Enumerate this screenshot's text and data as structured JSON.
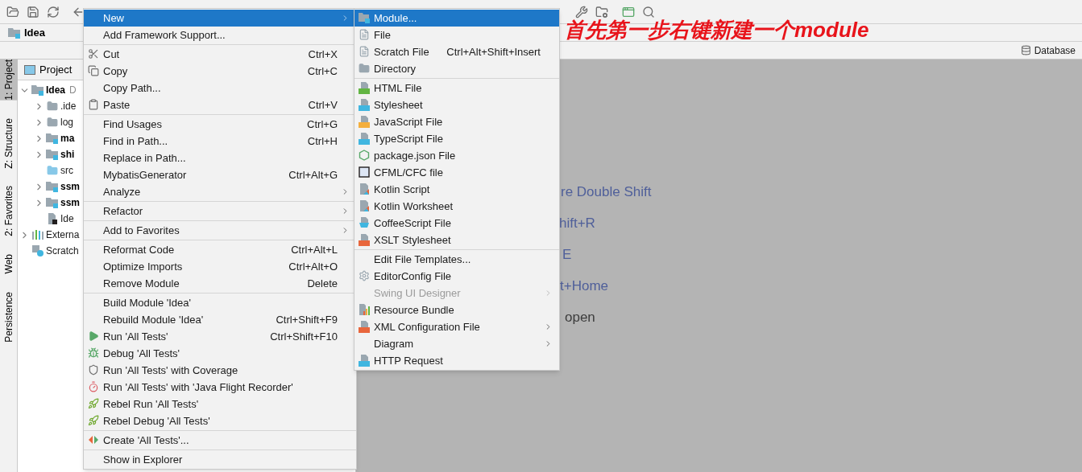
{
  "navbar": {
    "project": "Idea"
  },
  "tool_strip": {
    "database": "Database"
  },
  "side_tabs": [
    {
      "label": "1: Project",
      "selected": true
    },
    {
      "label": "Z: Structure",
      "selected": false
    },
    {
      "label": "2: Favorites",
      "selected": false
    },
    {
      "label": "Web",
      "selected": false
    },
    {
      "label": "Persistence",
      "selected": false
    }
  ],
  "project_panel": {
    "title": "Project",
    "tree": [
      {
        "label": "Idea",
        "suffix": "D",
        "kind": "module",
        "expanded": true,
        "children": [
          {
            "label": ".ide",
            "kind": "folder",
            "expanded": false
          },
          {
            "label": "log",
            "kind": "folder",
            "expanded": false
          },
          {
            "label": "ma",
            "kind": "module",
            "expanded": false
          },
          {
            "label": "shi",
            "kind": "module",
            "expanded": false
          },
          {
            "label": "src",
            "kind": "source"
          },
          {
            "label": "ssm",
            "kind": "module",
            "expanded": false
          },
          {
            "label": "ssm",
            "kind": "module",
            "expanded": false
          },
          {
            "label": "Ide",
            "kind": "file"
          }
        ]
      },
      {
        "label": "Externa",
        "kind": "library",
        "expanded": false
      },
      {
        "label": "Scratch",
        "kind": "scratch"
      }
    ]
  },
  "editor_hints": [
    "re Double Shift",
    "hift+R",
    "E",
    "t+Home",
    "open"
  ],
  "annotation": "首先第一步右键新建一个module",
  "context_menu": {
    "groups": [
      [
        {
          "label": "New",
          "selected": true,
          "submenu": true
        },
        {
          "label": "Add Framework Support...",
          "selected": false,
          "submenu": false
        }
      ],
      [
        {
          "label": "Cut",
          "shortcut": "Ctrl+X",
          "selected": false,
          "submenu": false
        },
        {
          "label": "Copy",
          "shortcut": "Ctrl+C",
          "selected": false,
          "submenu": false
        },
        {
          "label": "Copy Path...",
          "selected": false,
          "submenu": false
        },
        {
          "label": "Paste",
          "shortcut": "Ctrl+V",
          "selected": false,
          "submenu": false
        }
      ],
      [
        {
          "label": "Find Usages",
          "shortcut": "Ctrl+G",
          "selected": false,
          "submenu": false
        },
        {
          "label": "Find in Path...",
          "shortcut": "Ctrl+H",
          "selected": false,
          "submenu": false
        },
        {
          "label": "Replace in Path...",
          "selected": false,
          "submenu": false
        },
        {
          "label": "MybatisGenerator",
          "shortcut": "Ctrl+Alt+G",
          "selected": false,
          "submenu": false
        },
        {
          "label": "Analyze",
          "selected": false,
          "submenu": true
        }
      ],
      [
        {
          "label": "Refactor",
          "selected": false,
          "submenu": true
        }
      ],
      [
        {
          "label": "Add to Favorites",
          "selected": false,
          "submenu": true
        }
      ],
      [
        {
          "label": "Reformat Code",
          "shortcut": "Ctrl+Alt+L",
          "selected": false,
          "submenu": false
        },
        {
          "label": "Optimize Imports",
          "shortcut": "Ctrl+Alt+O",
          "selected": false,
          "submenu": false
        },
        {
          "label": "Remove Module",
          "shortcut": "Delete",
          "selected": false,
          "submenu": false
        }
      ],
      [
        {
          "label": "Build Module 'Idea'",
          "selected": false,
          "submenu": false
        },
        {
          "label": "Rebuild Module 'Idea'",
          "shortcut": "Ctrl+Shift+F9",
          "selected": false,
          "submenu": false
        },
        {
          "label": "Run 'All Tests'",
          "shortcut": "Ctrl+Shift+F10",
          "selected": false,
          "submenu": false
        },
        {
          "label": "Debug 'All Tests'",
          "selected": false,
          "submenu": false
        },
        {
          "label": "Run 'All Tests' with Coverage",
          "selected": false,
          "submenu": false
        },
        {
          "label": "Run 'All Tests' with 'Java Flight Recorder'",
          "selected": false,
          "submenu": false
        },
        {
          "label": "Rebel Run 'All Tests'",
          "selected": false,
          "submenu": false
        },
        {
          "label": "Rebel Debug 'All Tests'",
          "selected": false,
          "submenu": false
        }
      ],
      [
        {
          "label": "Create 'All Tests'...",
          "selected": false,
          "submenu": false
        }
      ],
      [
        {
          "label": "Show in Explorer",
          "selected": false,
          "submenu": false
        }
      ]
    ]
  },
  "new_submenu": {
    "groups": [
      [
        {
          "label": "Module...",
          "selected": true,
          "disabled": false,
          "submenu": false
        },
        {
          "label": "File",
          "selected": false,
          "disabled": false,
          "submenu": false
        },
        {
          "label": "Scratch File",
          "shortcut": "Ctrl+Alt+Shift+Insert",
          "selected": false,
          "disabled": false,
          "submenu": false
        },
        {
          "label": "Directory",
          "selected": false,
          "disabled": false,
          "submenu": false
        }
      ],
      [
        {
          "label": "HTML File",
          "selected": false,
          "disabled": false,
          "submenu": false
        },
        {
          "label": "Stylesheet",
          "selected": false,
          "disabled": false,
          "submenu": false
        },
        {
          "label": "JavaScript File",
          "selected": false,
          "disabled": false,
          "submenu": false
        },
        {
          "label": "TypeScript File",
          "selected": false,
          "disabled": false,
          "submenu": false
        },
        {
          "label": "package.json File",
          "selected": false,
          "disabled": false,
          "submenu": false
        },
        {
          "label": "CFML/CFC file",
          "selected": false,
          "disabled": false,
          "submenu": false
        },
        {
          "label": "Kotlin Script",
          "selected": false,
          "disabled": false,
          "submenu": false
        },
        {
          "label": "Kotlin Worksheet",
          "selected": false,
          "disabled": false,
          "submenu": false
        },
        {
          "label": "CoffeeScript File",
          "selected": false,
          "disabled": false,
          "submenu": false
        },
        {
          "label": "XSLT Stylesheet",
          "selected": false,
          "disabled": false,
          "submenu": false
        }
      ],
      [
        {
          "label": "Edit File Templates...",
          "selected": false,
          "disabled": false,
          "submenu": false
        },
        {
          "label": "EditorConfig File",
          "selected": false,
          "disabled": false,
          "submenu": false
        },
        {
          "label": "Swing UI Designer",
          "selected": false,
          "disabled": true,
          "submenu": true
        },
        {
          "label": "Resource Bundle",
          "selected": false,
          "disabled": false,
          "submenu": false
        },
        {
          "label": "XML Configuration File",
          "selected": false,
          "disabled": false,
          "submenu": true
        },
        {
          "label": "Diagram",
          "selected": false,
          "disabled": false,
          "submenu": true
        },
        {
          "label": "HTTP Request",
          "selected": false,
          "disabled": false,
          "submenu": false
        }
      ]
    ]
  }
}
